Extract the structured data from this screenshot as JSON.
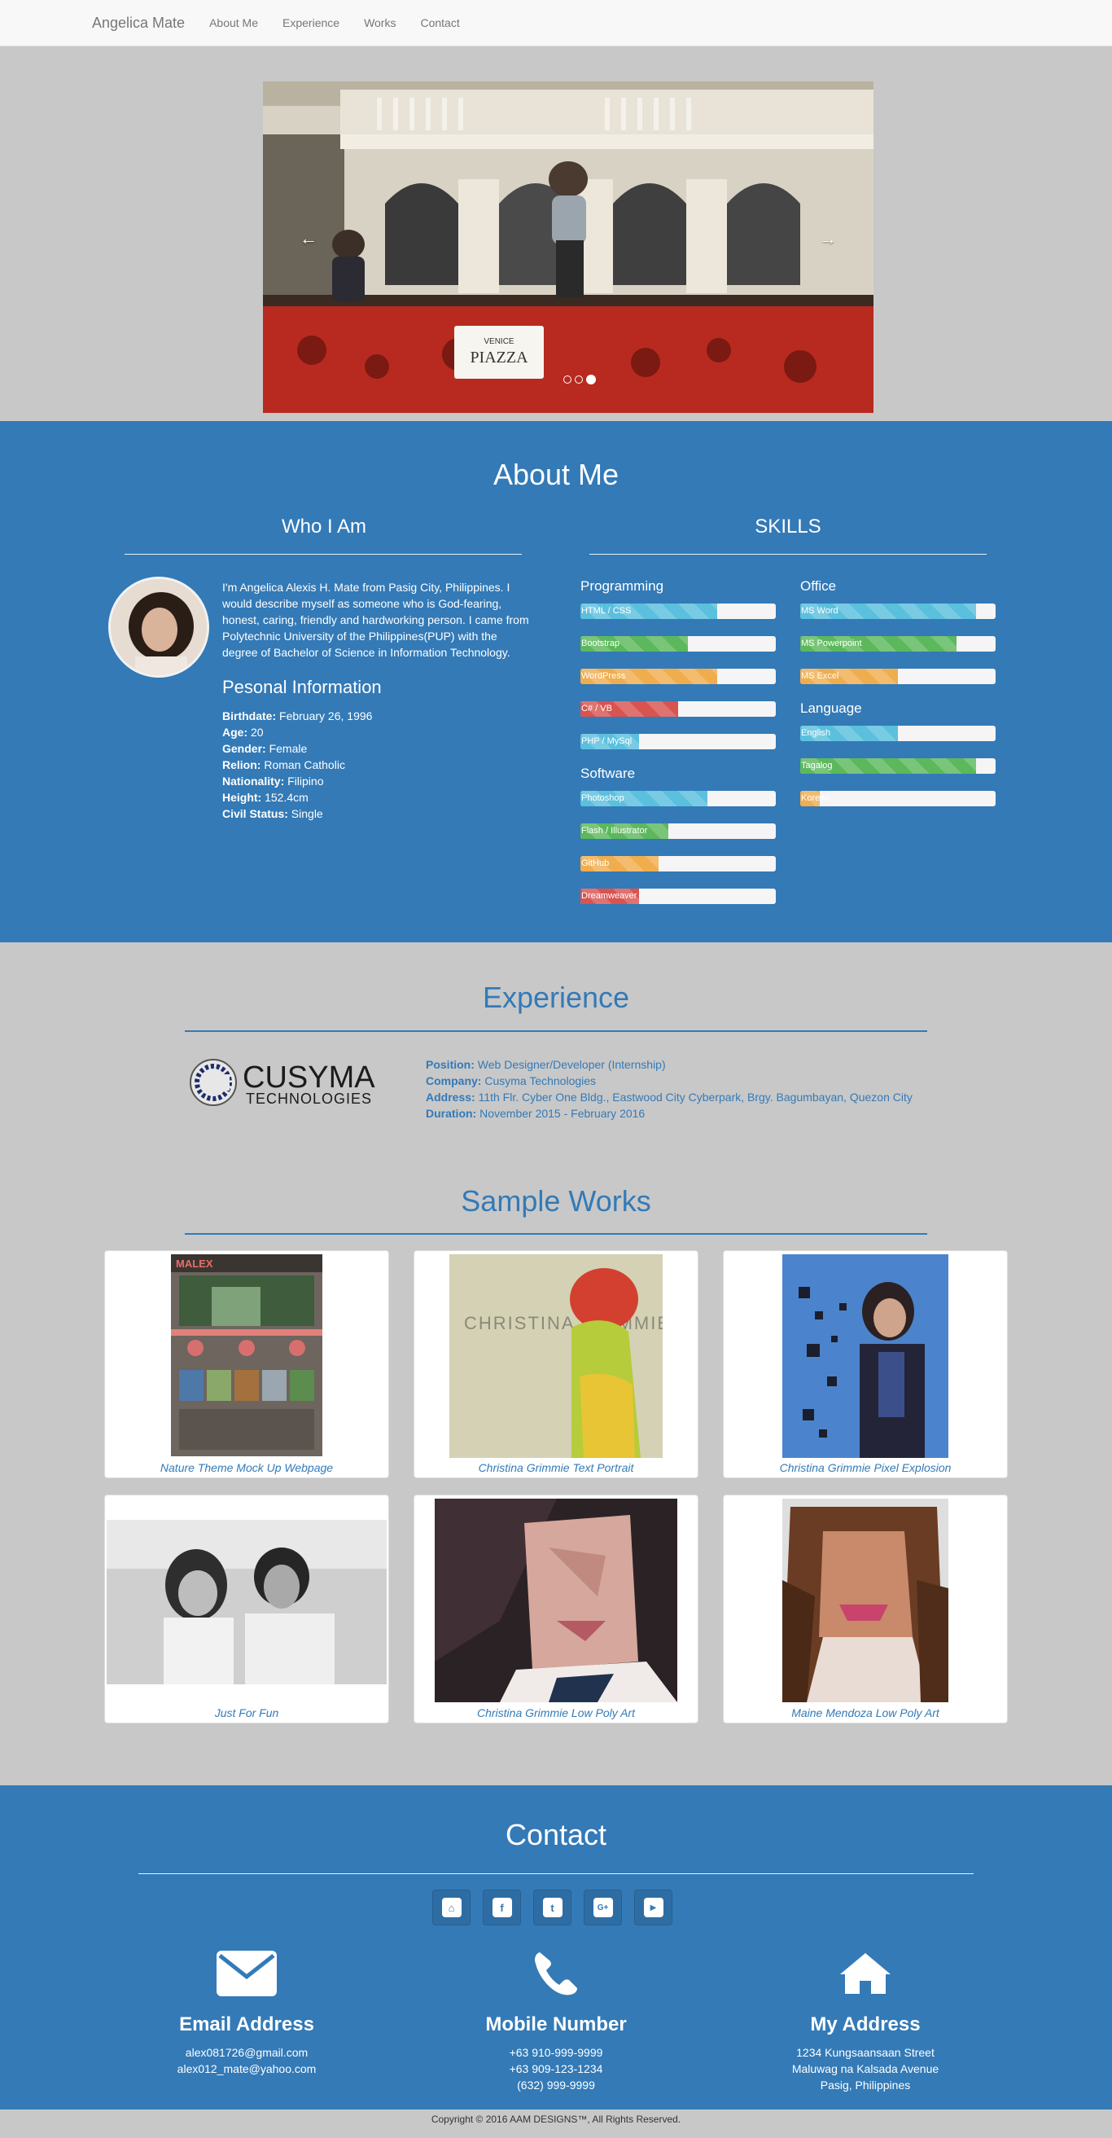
{
  "navbar": {
    "brand": "Angelica Mate",
    "links": [
      "About Me",
      "Experience",
      "Works",
      "Contact"
    ]
  },
  "carousel": {
    "prev_icon": "chevron-left-icon",
    "next_icon": "chevron-right-icon",
    "slides": 3,
    "active_slide": 3,
    "sign_line1": "VENICE",
    "sign_line2": "PIAZZA"
  },
  "about": {
    "title": "About Me",
    "who_title": "Who I Am",
    "skills_title": "SKILLS",
    "bio": "I'm Angelica Alexis H. Mate from Pasig City, Philippines. I would describe myself as someone who is God-fearing, honest, caring, friendly and hardworking person. I came from Polytechnic University of the Philippines(PUP) with the degree of Bachelor of Science in Information Technology.",
    "personal_title": "Pesonal Information",
    "personal": [
      {
        "label": "Birthdate:",
        "value": "February 26, 1996"
      },
      {
        "label": "Age:",
        "value": "20"
      },
      {
        "label": "Gender:",
        "value": "Female"
      },
      {
        "label": "Relion:",
        "value": "Roman Catholic"
      },
      {
        "label": "Nationality:",
        "value": "Filipino"
      },
      {
        "label": "Height:",
        "value": "152.4cm"
      },
      {
        "label": "Civil Status:",
        "value": "Single"
      }
    ],
    "skill_groups": [
      {
        "title": "Programming",
        "skills": [
          {
            "name": "HTML / CSS",
            "level": 0.7,
            "color": "#5bc0de"
          },
          {
            "name": "Bootstrap",
            "level": 0.55,
            "color": "#5cb85c"
          },
          {
            "name": "WordPress",
            "level": 0.7,
            "color": "#f0ad4e"
          },
          {
            "name": "C# / VB",
            "level": 0.5,
            "color": "#d9534f"
          },
          {
            "name": "PHP / MySql",
            "level": 0.3,
            "color": "#5bc0de"
          }
        ]
      },
      {
        "title": "Software",
        "skills": [
          {
            "name": "Photoshop",
            "level": 0.65,
            "color": "#5bc0de"
          },
          {
            "name": "Flash / Illustrator",
            "level": 0.45,
            "color": "#5cb85c"
          },
          {
            "name": "GitHub",
            "level": 0.4,
            "color": "#f0ad4e"
          },
          {
            "name": "Dreamweaver",
            "level": 0.3,
            "color": "#d9534f"
          }
        ]
      },
      {
        "title": "Office",
        "skills": [
          {
            "name": "MS Word",
            "level": 0.9,
            "color": "#5bc0de"
          },
          {
            "name": "MS Powerpoint",
            "level": 0.8,
            "color": "#5cb85c"
          },
          {
            "name": "MS Excel",
            "level": 0.5,
            "color": "#f0ad4e"
          }
        ]
      },
      {
        "title": "Language",
        "skills": [
          {
            "name": "English",
            "level": 0.5,
            "color": "#5bc0de"
          },
          {
            "name": "Tagalog",
            "level": 0.9,
            "color": "#5cb85c"
          },
          {
            "name": "Korean",
            "level": 0.1,
            "color": "#f0ad4e"
          }
        ]
      }
    ]
  },
  "experience": {
    "title": "Experience",
    "logo_text": "CUSYMA",
    "logo_sub": "TECHNOLOGIES",
    "fields": [
      {
        "label": "Position:",
        "value": "Web Designer/Developer (Internship)"
      },
      {
        "label": "Company:",
        "value": "Cusyma Technologies"
      },
      {
        "label": "Address:",
        "value": "11th Flr. Cyber One Bldg., Eastwood City Cyberpark, Brgy. Bagumbayan, Quezon City"
      },
      {
        "label": "Duration:",
        "value": "November 2015 - February 2016"
      }
    ]
  },
  "works": {
    "title": "Sample Works",
    "items": [
      {
        "caption": "Nature Theme Mock Up Webpage",
        "thumb_text": "MALEX"
      },
      {
        "caption": "Christina Grimmie Text Portrait",
        "thumb_text": "CHRISTINA GRIMMIE"
      },
      {
        "caption": "Christina Grimmie Pixel Explosion",
        "thumb_text": ""
      },
      {
        "caption": "Just For Fun",
        "thumb_text": ""
      },
      {
        "caption": "Christina Grimmie Low Poly Art",
        "thumb_text": ""
      },
      {
        "caption": "Maine Mendoza Low Poly Art",
        "thumb_text": ""
      }
    ]
  },
  "contact": {
    "title": "Contact",
    "social": [
      {
        "icon": "github-icon",
        "glyph": "⌂"
      },
      {
        "icon": "facebook-icon",
        "glyph": "f"
      },
      {
        "icon": "twitter-icon",
        "glyph": "t"
      },
      {
        "icon": "google-plus-icon",
        "glyph": "G+"
      },
      {
        "icon": "youtube-icon",
        "glyph": "▶"
      }
    ],
    "email": {
      "title": "Email Address",
      "lines": [
        "alex081726@gmail.com",
        "alex012_mate@yahoo.com"
      ]
    },
    "phone": {
      "title": "Mobile Number",
      "lines": [
        "+63 910-999-9999",
        "+63 909-123-1234",
        "(632) 999-9999"
      ]
    },
    "address": {
      "title": "My Address",
      "lines": [
        "1234 Kungsaansaan Street",
        "Maluwag na Kalsada Avenue",
        "Pasig, Philippines"
      ]
    }
  },
  "footer": {
    "copyright": "Copyright © 2016 AAM DESIGNS™, All Rights Reserved."
  }
}
